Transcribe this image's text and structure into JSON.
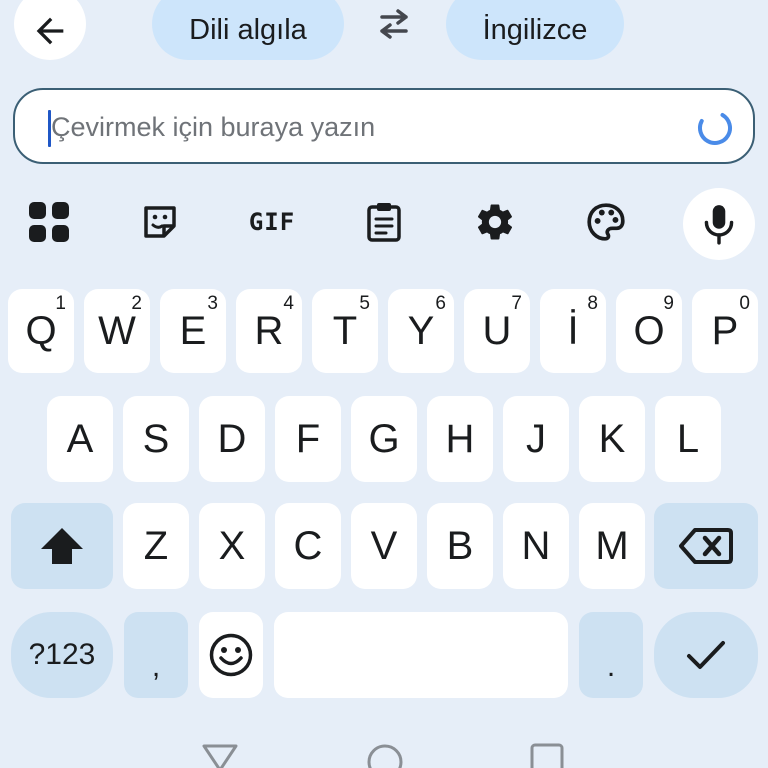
{
  "header": {
    "source_language": "Dili algıla",
    "target_language": "İngilizce",
    "icons": {
      "back": "arrow-left-icon",
      "swap": "swap-arrows-icon"
    }
  },
  "input": {
    "placeholder": "Çevirmek için buraya yazın",
    "value": "",
    "status_icon": "loading-spinner-icon",
    "accent_color": "#4a8be8"
  },
  "toolbar": {
    "items": [
      {
        "icon": "apps-grid-icon"
      },
      {
        "icon": "sticker-icon"
      },
      {
        "icon": "gif-icon",
        "label": "GIF"
      },
      {
        "icon": "clipboard-icon"
      },
      {
        "icon": "settings-gear-icon"
      },
      {
        "icon": "palette-icon"
      },
      {
        "icon": "microphone-icon"
      }
    ]
  },
  "keyboard": {
    "row1": [
      {
        "label": "Q",
        "hint": "1"
      },
      {
        "label": "W",
        "hint": "2"
      },
      {
        "label": "E",
        "hint": "3"
      },
      {
        "label": "R",
        "hint": "4"
      },
      {
        "label": "T",
        "hint": "5"
      },
      {
        "label": "Y",
        "hint": "6"
      },
      {
        "label": "U",
        "hint": "7"
      },
      {
        "label": "İ",
        "hint": "8"
      },
      {
        "label": "O",
        "hint": "9"
      },
      {
        "label": "P",
        "hint": "0"
      }
    ],
    "row2": [
      "A",
      "S",
      "D",
      "F",
      "G",
      "H",
      "J",
      "K",
      "L"
    ],
    "row3": [
      "Z",
      "X",
      "C",
      "V",
      "B",
      "N",
      "M"
    ],
    "row4": {
      "symbols": "?123",
      "comma": ",",
      "period": ".",
      "icons": {
        "emoji": "emoji-smile-icon",
        "enter": "checkmark-icon",
        "shift": "shift-arrow-icon",
        "backspace": "backspace-icon"
      }
    },
    "colors": {
      "key": "#ffffff",
      "function_key": "#cde1f2",
      "background": "#e6eef8"
    }
  },
  "navbar": {
    "icons": [
      "back-triangle-icon",
      "home-circle-icon",
      "recents-square-icon"
    ]
  }
}
